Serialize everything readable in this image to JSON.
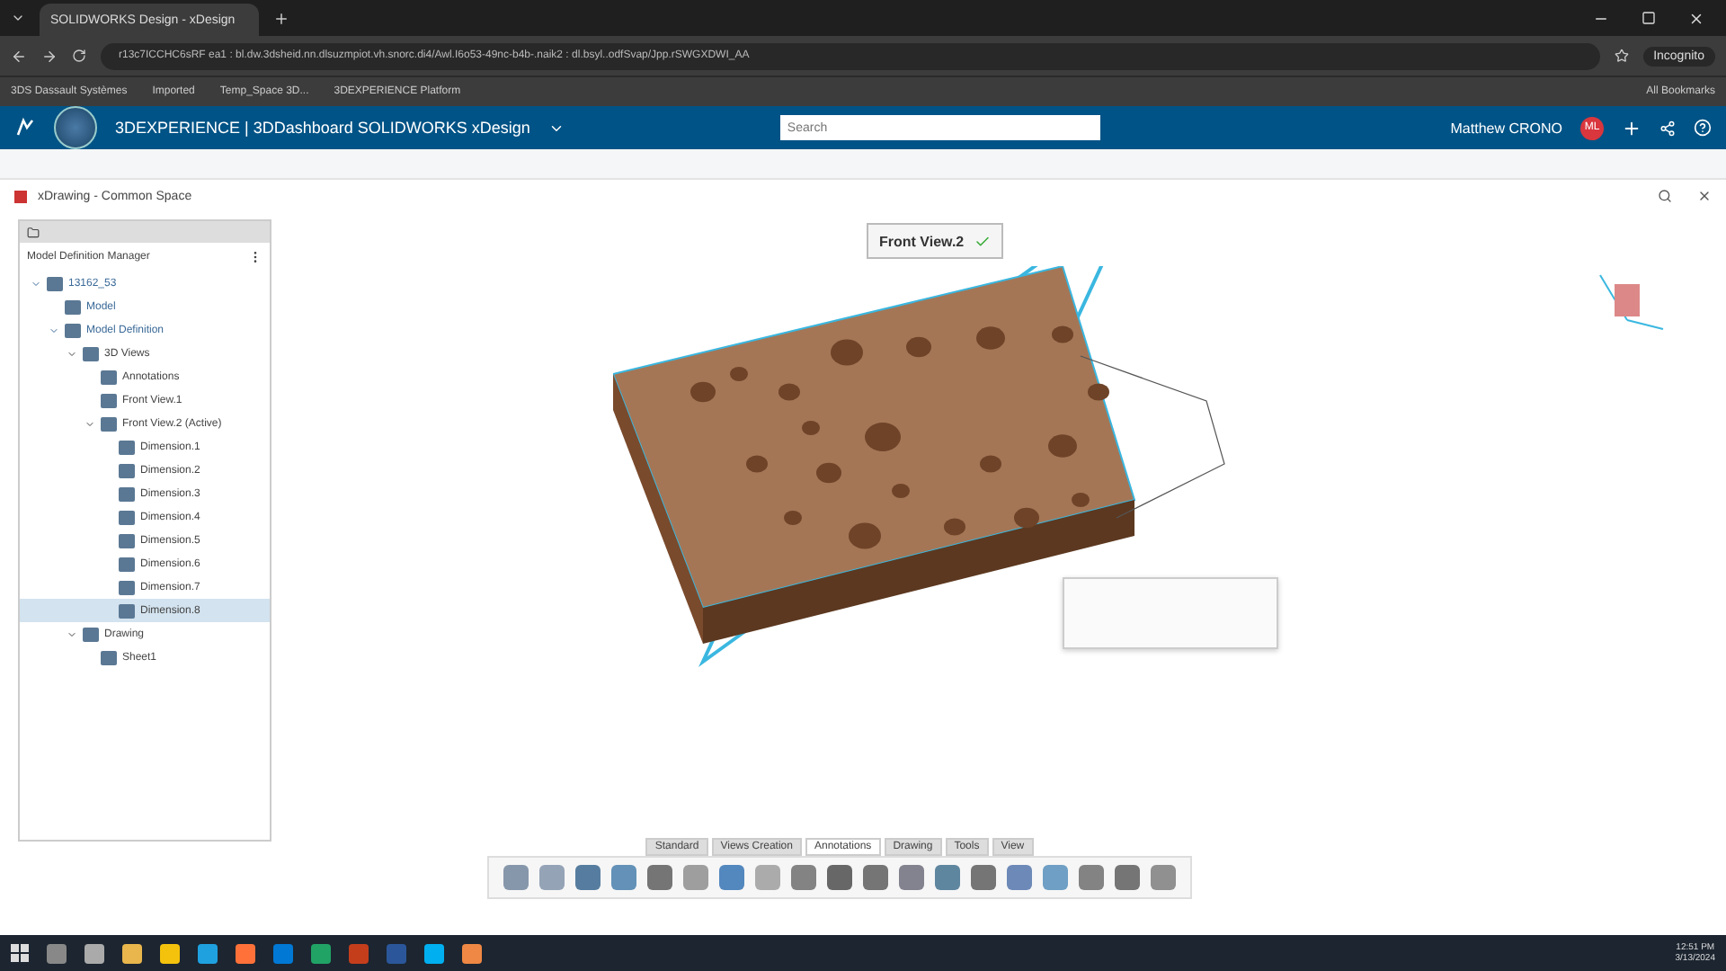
{
  "browser": {
    "tab_title": "SOLIDWORKS Design - xDesign",
    "url": "r13c7ICCHC6sRF ea1 : bl.dw.3dsheid.nn.dlsuzmpiot.vh.snorc.di4/Awl.I6o53-49nc-b4b-.naik2 : dl.bsyl..odfSvap/Jpp.rSWGXDWI_AA",
    "incognito": "Incognito",
    "bookmarks": [
      "3DS Dassault Systèmes",
      "Imported",
      "Temp_Space 3D...",
      "3DEXPERIENCE Platform"
    ],
    "all_bookmarks": "All Bookmarks"
  },
  "header": {
    "brand": "3DEXPERIENCE | 3DDashboard SOLIDWORKS xDesign",
    "search_placeholder": "Search",
    "user": "Matthew CRONO",
    "avatar": "ML"
  },
  "app": {
    "title": "xDrawing - Common Space"
  },
  "tree": {
    "title": "Model Definition Manager",
    "items": [
      {
        "label": "13162_53",
        "expanded": true,
        "selected": false,
        "children": [
          {
            "label": "Model",
            "expanded": false,
            "selected": false
          },
          {
            "label": "Model Definition",
            "expanded": true,
            "selected": false,
            "children": [
              {
                "label": "3D Views",
                "expanded": true,
                "selected": false,
                "children": [
                  {
                    "label": "Annotations",
                    "expanded": false,
                    "selected": false
                  },
                  {
                    "label": "Front View.1",
                    "expanded": false,
                    "selected": false
                  },
                  {
                    "label": "Front View.2 (Active)",
                    "expanded": true,
                    "selected": false,
                    "children": [
                      {
                        "label": "Dimension.1",
                        "expanded": false,
                        "selected": false
                      },
                      {
                        "label": "Dimension.2",
                        "expanded": false,
                        "selected": false
                      },
                      {
                        "label": "Dimension.3",
                        "expanded": false,
                        "selected": false
                      },
                      {
                        "label": "Dimension.4",
                        "expanded": false,
                        "selected": false
                      },
                      {
                        "label": "Dimension.5",
                        "expanded": false,
                        "selected": false
                      },
                      {
                        "label": "Dimension.6",
                        "expanded": false,
                        "selected": false
                      },
                      {
                        "label": "Dimension.7",
                        "expanded": false,
                        "selected": false
                      },
                      {
                        "label": "Dimension.8",
                        "expanded": false,
                        "selected": true
                      }
                    ]
                  }
                ]
              },
              {
                "label": "Drawing",
                "expanded": true,
                "selected": false,
                "children": [
                  {
                    "label": "Sheet1",
                    "expanded": false,
                    "selected": false
                  }
                ]
              }
            ]
          }
        ]
      }
    ]
  },
  "view_popup": {
    "label": "Front View.2"
  },
  "toolbar_tabs": [
    {
      "label": "Standard",
      "selected": false
    },
    {
      "label": "Views Creation",
      "selected": false
    },
    {
      "label": "Annotations",
      "selected": true
    },
    {
      "label": "Drawing",
      "selected": false
    },
    {
      "label": "Tools",
      "selected": false
    },
    {
      "label": "View",
      "selected": false
    }
  ],
  "taskbar": {
    "time": "12:51 PM",
    "date": "3/13/2024"
  }
}
